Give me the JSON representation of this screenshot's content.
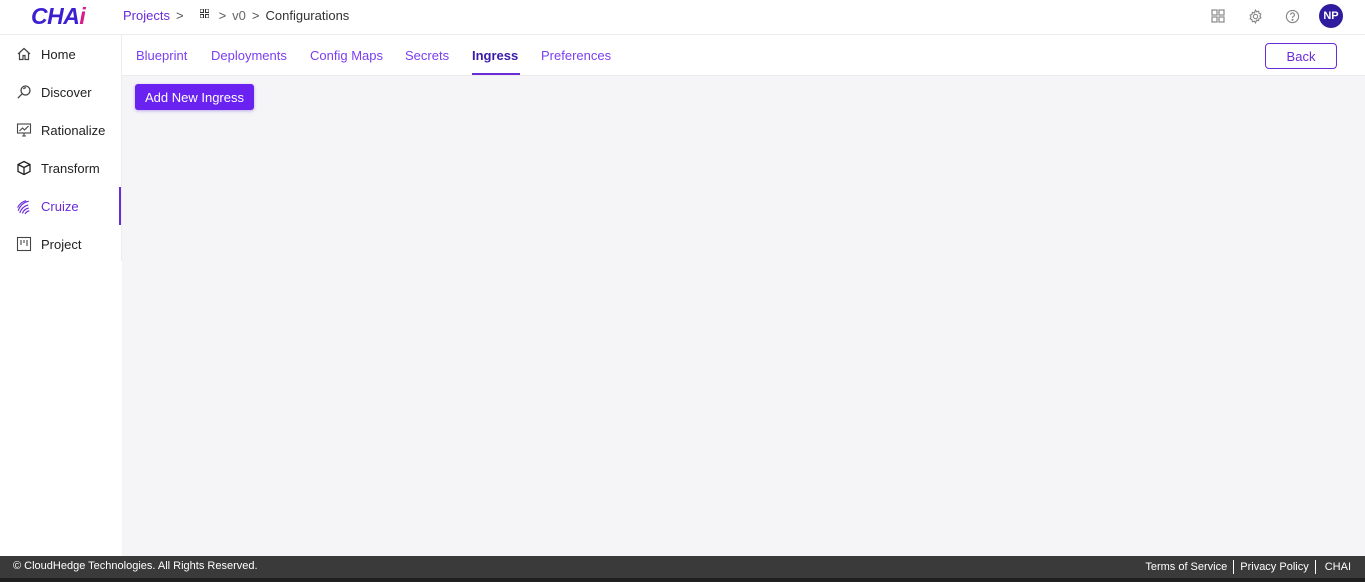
{
  "header": {
    "logo_text": "CHA",
    "logo_accent": "i",
    "breadcrumb": {
      "projects_label": "Projects",
      "separator": ">",
      "grid_icon": "grid-icon",
      "version": "v0",
      "current": "Configurations"
    },
    "icons": [
      "apps-grid-icon",
      "gear-icon",
      "help-icon"
    ],
    "avatar_initials": "NP"
  },
  "sidebar": {
    "items": [
      {
        "label": "Home",
        "icon": "home-icon",
        "active": false
      },
      {
        "label": "Discover",
        "icon": "search-icon",
        "active": false
      },
      {
        "label": "Rationalize",
        "icon": "chart-icon",
        "active": false
      },
      {
        "label": "Transform",
        "icon": "cube-icon",
        "active": false
      },
      {
        "label": "Cruize",
        "icon": "fingerprint-icon",
        "active": true
      },
      {
        "label": "Project",
        "icon": "board-icon",
        "active": false
      }
    ]
  },
  "tabs": [
    {
      "label": "Blueprint",
      "active": false
    },
    {
      "label": "Deployments",
      "active": false
    },
    {
      "label": "Config Maps",
      "active": false
    },
    {
      "label": "Secrets",
      "active": false
    },
    {
      "label": "Ingress",
      "active": true
    },
    {
      "label": "Preferences",
      "active": false
    }
  ],
  "actions": {
    "back_label": "Back",
    "add_label": "Add New Ingress"
  },
  "footer": {
    "copyright": "© CloudHedge Technologies. All Rights Reserved.",
    "links": [
      "Terms of Service",
      "Privacy Policy",
      "CHAI"
    ]
  },
  "colors": {
    "accent": "#6a2bd9",
    "primary_button": "#6a22f0",
    "avatar": "#2e1b9e",
    "footer": "#3a3a3a",
    "logo_primary": "#3b1fd1",
    "logo_accent": "#d81b8c"
  }
}
